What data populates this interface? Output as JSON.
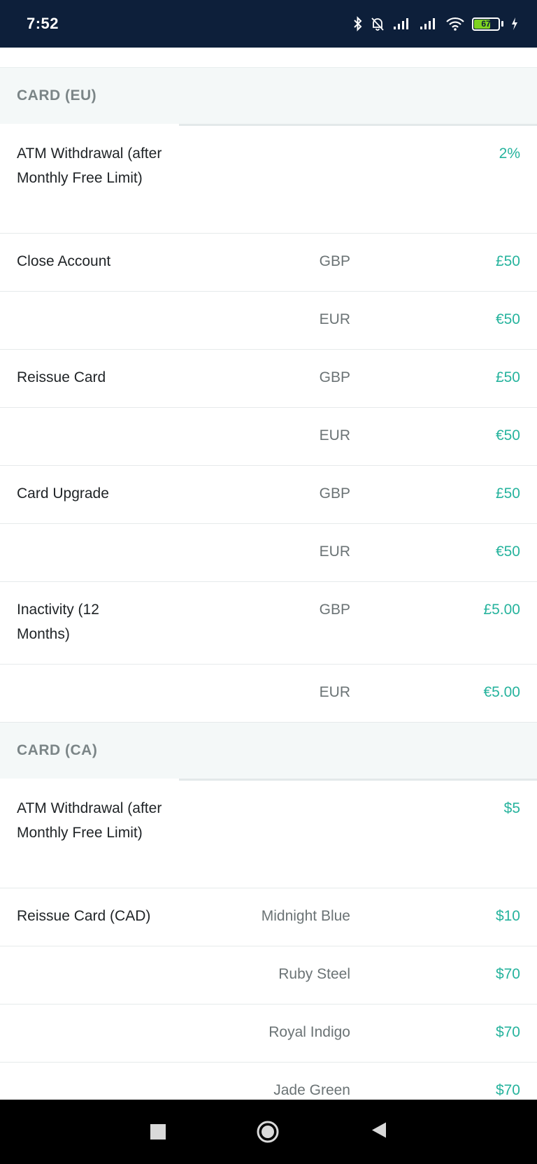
{
  "status_bar": {
    "time": "7:52",
    "battery_level": "67",
    "icons": [
      "bluetooth-icon",
      "bell-off-icon",
      "signal-icon",
      "signal-icon",
      "wifi-icon",
      "battery-icon",
      "charging-icon"
    ]
  },
  "colors": {
    "status_bar_bg": "#0d1f3a",
    "accent_value": "#26b39d",
    "section_header_bg": "#f4f8f8",
    "battery_fill": "#7ed321"
  },
  "sections": {
    "eu": {
      "title": "CARD (EU)",
      "rows": [
        {
          "name": "ATM Withdrawal (after Monthly Free Limit)",
          "variant": "",
          "value": "2%"
        },
        {
          "name": "Close Account",
          "variant": "GBP",
          "value": "£50"
        },
        {
          "name": "",
          "variant": "EUR",
          "value": "€50"
        },
        {
          "name": "Reissue Card",
          "variant": "GBP",
          "value": "£50"
        },
        {
          "name": "",
          "variant": "EUR",
          "value": "€50"
        },
        {
          "name": "Card Upgrade",
          "variant": "GBP",
          "value": "£50"
        },
        {
          "name": "",
          "variant": "EUR",
          "value": "€50"
        },
        {
          "name": "Inactivity (12 Months)",
          "variant": "GBP",
          "value": "£5.00"
        },
        {
          "name": "",
          "variant": "EUR",
          "value": "€5.00"
        }
      ]
    },
    "ca": {
      "title": "CARD (CA)",
      "rows": [
        {
          "name": "ATM Withdrawal (after Monthly Free Limit)",
          "variant": "",
          "value": "$5"
        },
        {
          "name": "Reissue Card (CAD)",
          "variant": "Midnight Blue",
          "value": "$10"
        },
        {
          "name": "",
          "variant": "Ruby Steel",
          "value": "$70"
        },
        {
          "name": "",
          "variant": "Royal Indigo",
          "value": "$70"
        },
        {
          "name": "",
          "variant": "Jade Green",
          "value": "$70"
        }
      ]
    }
  },
  "nav_bar": {
    "buttons": [
      "recents-button",
      "home-button",
      "back-button"
    ]
  }
}
